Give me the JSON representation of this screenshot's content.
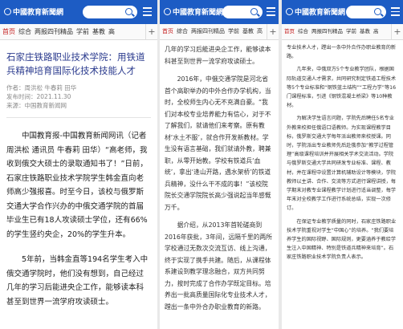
{
  "site": {
    "logo_text": "中國教育新聞網"
  },
  "nav": {
    "items": [
      "首页",
      "综合",
      "两报四刊精品",
      "学前",
      "基教",
      "高"
    ]
  },
  "article": {
    "title": "石家庄铁路职业技术学院：用铁道兵精神培育国际化技术技能人才",
    "author": "作者：周洪松 牛春莉 田华",
    "date": "发布时间：2021.11.30",
    "source": "来源：中国教育新闻网"
  },
  "panel1": {
    "paragraphs": [
      "中国教育报-中国教育新闻网讯（记者 周洪松 通讯员 牛春莉 田华）“高老师，我收到俄交大硕士的录取通知书了！”日前，石家庄铁路职业技术学院学生韩金直向老师高少强报喜。时至今日，该校与俄罗斯交通大学合作兴办的中俄交通学院的首届毕业生已有18人攻读硕士学位，还有66%的学生竖约央企，20%的学生升本。",
      "5年前，当韩金直等194名学生考入中俄交通学院时，他们没有想到，自己经过几年的学习后能进央企工作，能够读本科甚至到世界一流学府攻读硕士。"
    ]
  },
  "panel2": {
    "paragraphs": [
      "几年的学习后能进央企工作，能够读本科甚至到世界一流学府攻读硕士。",
      "2016年，中俄交通学院是河北省首个高职举办的中外合作办学机构，当时，全校师生内心无不充满自豪。“我们对本校专业培养能力有信心，对于不了解我们，就请他们来考察。原有教材‘水土不服’，就合作开发新教材。学生没有语言基础，我们就请外教，聘兼职，从零开始教。学校有铁道兵‘血统’，拿出‘逢山开路，遇水架桥’的铁道兵精神，没什么干不成的事！”该校院院长交通学院院长高少强说起当年感慨万千。",
      "据介绍，从2013年首轮磋商到2016年获批，3年间，远隔千里的两所学校通过无数次交流互访、线上沟通，终于实现了携手共建。随后，从课程体系建设到教学理念融合，双方共同努力，按时完成了合作办学既定目标。培养出一批高质量国际化专业技术人才，蹚出一条中外合办职业教育的新路。"
    ]
  },
  "panel3": {
    "paragraphs": [
      "专业技术人才，蹚出一条中外合作办职业教育的新路。",
      "几年来，中俄双方5个专业教学团队，根据国际轨道交通人才需求，共同研究制定铁道工程技术等5个专业标准和“钢铁蓝土结构”“工程力学”等16门课程标准，引进《钢铁混凝土桥梁》等10种教材。",
      "为解决学生语言问题，学院先后聘任5名专业外教来校担任俄语口语教师。为实现课程教学目标，俄罗斯交通大学每年派出教师来校授课。同时，学院派出专业教师先后赴俄参加“教学过程管理”高级课程培训并开展相关学术交流活动。学院与俄罗斯交通大学共同研发专业标准、课程、教材，并在课程中设置计算机辅助设计等模块，学院教师以主讲、合作、交流等方式进行课程讲授，每学期末对教专业课程教学计划进行适当调整，每学年末对全校教学工作进行系统总结，实现一次修订。",
      "在保证专业教学质量的同时，石家庄铁路职业技术学院重视对学生“中国心”的培养。“我们要培养学生的国际视野、国际规则，更要涵养于教给学生注入中国精神、特别是铁道兵精神来培育”。石家庄铁路职业技术学院负责人表示。"
    ]
  }
}
